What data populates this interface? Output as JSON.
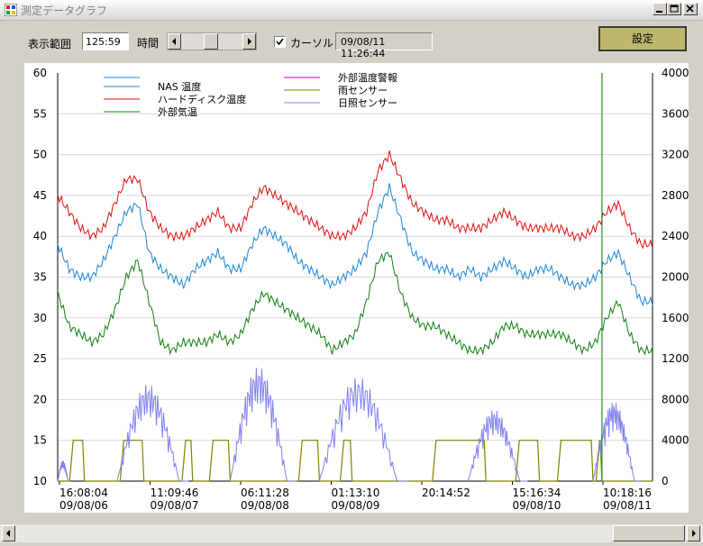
{
  "window": {
    "title": "測定データグラフ",
    "buttons": {
      "minimize": "0",
      "maximize": "1",
      "close": "r"
    }
  },
  "toolbar": {
    "range_label": "表示範囲",
    "range_value": "125:59",
    "time_label": "時間",
    "cursor_label": "カーソル",
    "cursor_checked": true,
    "cursor_time": "09/08/11 11:26:44",
    "settings_label": "設定"
  },
  "colors": {
    "nas": "#1c86d8",
    "hdd": "#e01010",
    "outside": "#108010",
    "alarm": "#c000c0",
    "rain": "#808000",
    "sun": "#8080f0",
    "cursor": "#2a8a2a",
    "settings_button": "#bdb76b"
  },
  "chart_data": {
    "type": "line",
    "left_axis": {
      "min": 10,
      "max": 60,
      "ticks": [
        "60",
        "55",
        "50",
        "45",
        "40",
        "35",
        "30",
        "25",
        "20",
        "15",
        "10"
      ]
    },
    "right_axis": {
      "min": 0,
      "max": 40000,
      "ticks": [
        "40000",
        "36000",
        "32000",
        "28000",
        "24000",
        "20000",
        "16000",
        "12000",
        "8000",
        "4000",
        "0"
      ]
    },
    "x_ticks": [
      {
        "time": "16:08:04",
        "date": "09/08/06"
      },
      {
        "time": "11:09:46",
        "date": "09/08/07"
      },
      {
        "time": "06:11:28",
        "date": "09/08/08"
      },
      {
        "time": "01:13:10",
        "date": "09/08/09"
      },
      {
        "time": "20:14:52",
        "date": ""
      },
      {
        "time": "15:16:34",
        "date": "09/08/10"
      },
      {
        "time": "10:18:16",
        "date": "09/08/11"
      }
    ],
    "legend_left": [
      "NAS 温度",
      "ハードディスク温度",
      "外部気温"
    ],
    "legend_right": [
      "外部温度警報",
      "雨センサー",
      "日照センサー"
    ],
    "series": [
      {
        "name": "NAS 温度",
        "axis": "left",
        "key": "nas",
        "values": [
          39,
          36,
          35,
          35,
          37,
          40,
          43,
          44,
          38,
          36,
          35,
          34,
          36,
          37,
          38,
          36,
          36,
          39,
          41,
          40,
          39,
          37,
          36,
          35,
          34,
          35,
          36,
          38,
          43,
          46,
          42,
          38,
          37,
          36,
          36,
          35,
          36,
          35,
          36,
          37,
          36,
          35,
          36,
          36,
          35,
          34,
          34,
          35,
          37,
          38,
          35,
          32,
          32
        ]
      },
      {
        "name": "ハードディスク温度",
        "axis": "left",
        "key": "hdd",
        "values": [
          45,
          43,
          41,
          40,
          41,
          44,
          47,
          47,
          43,
          41,
          40,
          40,
          41,
          42,
          43,
          41,
          41,
          44,
          46,
          45,
          44,
          43,
          42,
          41,
          40,
          40,
          41,
          43,
          48,
          50,
          47,
          44,
          43,
          42,
          42,
          41,
          41,
          41,
          42,
          43,
          42,
          41,
          41,
          41,
          41,
          40,
          40,
          41,
          43,
          44,
          41,
          39,
          39
        ]
      },
      {
        "name": "外部気温",
        "axis": "left",
        "key": "outside",
        "values": [
          33,
          29,
          28,
          27,
          28,
          31,
          35,
          37,
          32,
          27,
          26,
          27,
          27,
          27,
          28,
          27,
          28,
          31,
          33,
          32,
          31,
          30,
          29,
          28,
          26,
          27,
          28,
          32,
          37,
          38,
          33,
          30,
          29,
          29,
          28,
          27,
          26,
          26,
          27,
          29,
          29,
          28,
          28,
          28,
          28,
          27,
          26,
          27,
          30,
          32,
          28,
          26,
          26
        ]
      },
      {
        "name": "雨センサー",
        "axis": "right",
        "key": "rain",
        "on": 4000,
        "pulses": [
          [
            0.02,
            0.045
          ],
          [
            0.105,
            0.145
          ],
          [
            0.209,
            0.227
          ],
          [
            0.255,
            0.29
          ],
          [
            0.405,
            0.44
          ],
          [
            0.475,
            0.495
          ],
          [
            0.63,
            0.72
          ],
          [
            0.77,
            0.81
          ],
          [
            0.84,
            0.9
          ],
          [
            0.905,
            0.915
          ]
        ]
      },
      {
        "name": "日照センサー",
        "axis": "right",
        "key": "sun",
        "days": [
          {
            "start": 0.0,
            "end": 0.02,
            "peak": 2000
          },
          {
            "start": 0.1,
            "end": 0.22,
            "peak": 9500
          },
          {
            "start": 0.29,
            "end": 0.4,
            "peak": 11200
          },
          {
            "start": 0.44,
            "end": 0.59,
            "peak": 10200
          },
          {
            "start": 0.69,
            "end": 0.79,
            "peak": 7000
          },
          {
            "start": 0.9,
            "end": 0.98,
            "peak": 7800
          }
        ]
      }
    ],
    "cursor_position": 0.915,
    "grid": true
  }
}
